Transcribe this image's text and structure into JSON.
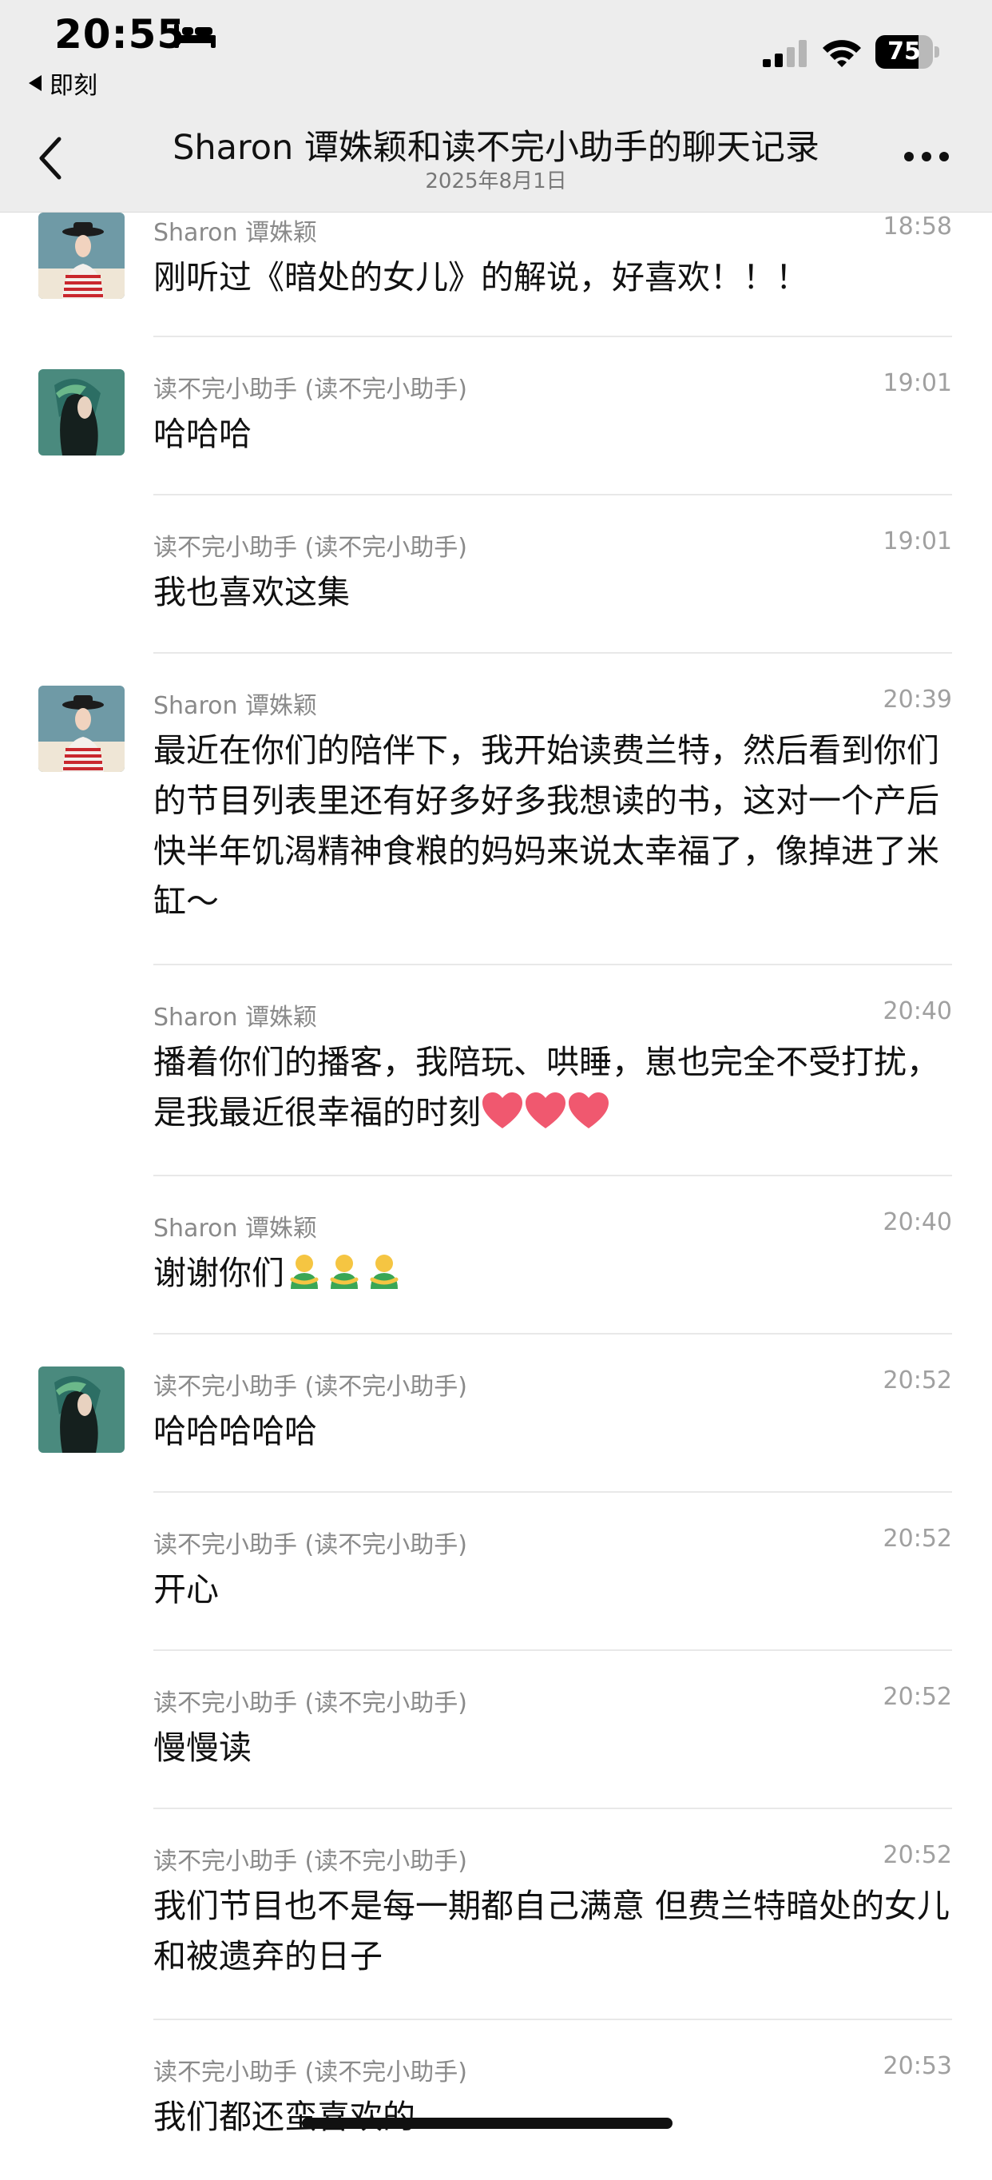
{
  "status_bar": {
    "time": "20:55",
    "back_app_label": "即刻",
    "battery_percent": "75",
    "battery_level": 0.75
  },
  "nav": {
    "title": "Sharon 谭姝颖和读不完小助手的聊天记录",
    "subtitle": "2025年8月1日"
  },
  "messages": [
    {
      "sender": "Sharon 谭姝颖",
      "time": "18:58",
      "text": "刚听过《暗处的女儿》的解说，好喜欢！！！",
      "avatar": "sharon"
    },
    {
      "sender": "读不完小助手 (读不完小助手)",
      "time": "19:01",
      "text": "哈哈哈",
      "avatar": "assistant"
    },
    {
      "sender": "读不完小助手 (读不完小助手)",
      "time": "19:01",
      "text": "我也喜欢这集",
      "avatar": ""
    },
    {
      "sender": "Sharon 谭姝颖",
      "time": "20:39",
      "text": "最近在你们的陪伴下，我开始读费兰特，然后看到你们的节目列表里还有好多好多我想读的书，这对一个产后快半年饥渴精神食粮的妈妈来说太幸福了，像掉进了米缸～",
      "avatar": "sharon"
    },
    {
      "sender": "Sharon 谭姝颖",
      "time": "20:40",
      "text": "播着你们的播客，我陪玩、哄睡，崽也完全不受打扰，是我最近很幸福的时刻",
      "emoji": "heart-icon",
      "emoji_count": 3,
      "avatar": ""
    },
    {
      "sender": "Sharon 谭姝颖",
      "time": "20:40",
      "text": "谢谢你们",
      "emoji": "hug-person-icon",
      "emoji_count": 3,
      "avatar": ""
    },
    {
      "sender": "读不完小助手 (读不完小助手)",
      "time": "20:52",
      "text": "哈哈哈哈哈",
      "avatar": "assistant"
    },
    {
      "sender": "读不完小助手 (读不完小助手)",
      "time": "20:52",
      "text": "开心",
      "avatar": ""
    },
    {
      "sender": "读不完小助手 (读不完小助手)",
      "time": "20:52",
      "text": "慢慢读",
      "avatar": ""
    },
    {
      "sender": "读不完小助手 (读不完小助手)",
      "time": "20:52",
      "text": "我们节目也不是每一期都自己满意 但费兰特暗处的女儿和被遗弃的日子",
      "avatar": ""
    },
    {
      "sender": "读不完小助手 (读不完小助手)",
      "time": "20:53",
      "text": "我们都还蛮喜欢的",
      "avatar": ""
    }
  ]
}
